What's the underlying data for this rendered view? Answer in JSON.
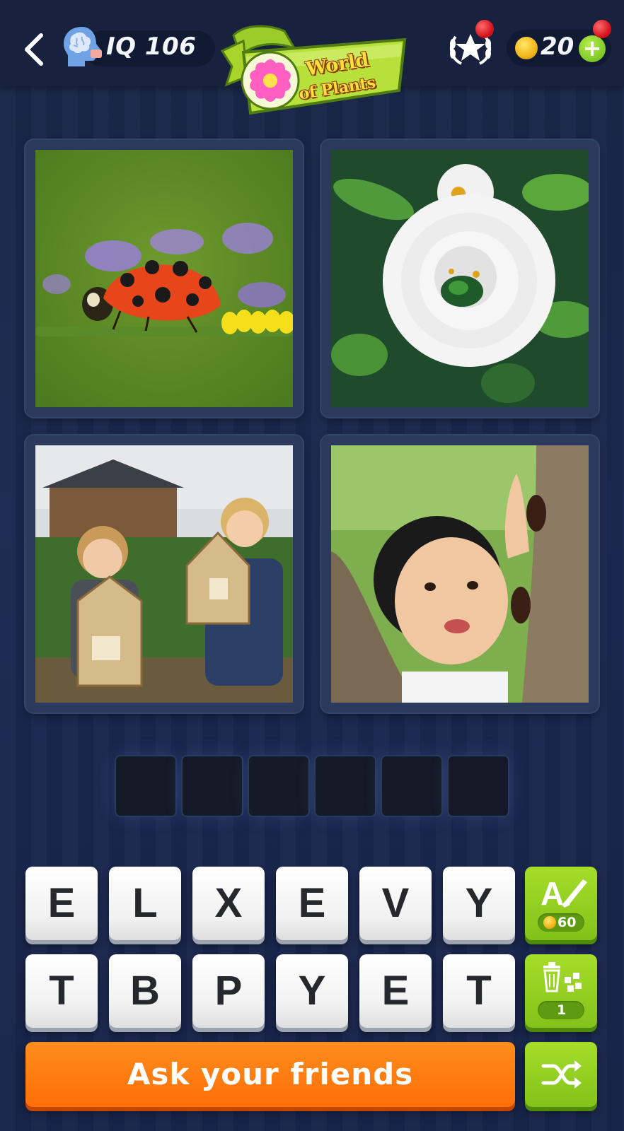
{
  "header": {
    "iq_label": "IQ 106",
    "banner_line1": "World",
    "banner_line2": "of Plants",
    "coins": "20",
    "add_coins_symbol": "+"
  },
  "puzzle": {
    "answer_length": 6,
    "answer_slots": [
      "",
      "",
      "",
      "",
      "",
      ""
    ],
    "letters_row1": [
      "E",
      "L",
      "X",
      "E",
      "V",
      "Y"
    ],
    "letters_row2": [
      "T",
      "B",
      "P",
      "Y",
      "E",
      "T"
    ]
  },
  "hints": {
    "reveal_letter_cost": "60",
    "remove_letters_count": "1"
  },
  "actions": {
    "ask_friends_label": "Ask your friends"
  },
  "colors": {
    "orange_button": "#ff7a10",
    "green_button": "#8ac51e",
    "background": "#1b2850"
  },
  "icons": {
    "back": "chevron-left-icon",
    "iq": "brain-icon",
    "achievements": "star-laurel-icon",
    "coin": "coin-icon",
    "reveal_letter": "letter-brush-icon",
    "remove_letters": "trash-icon",
    "shuffle": "shuffle-icon"
  }
}
